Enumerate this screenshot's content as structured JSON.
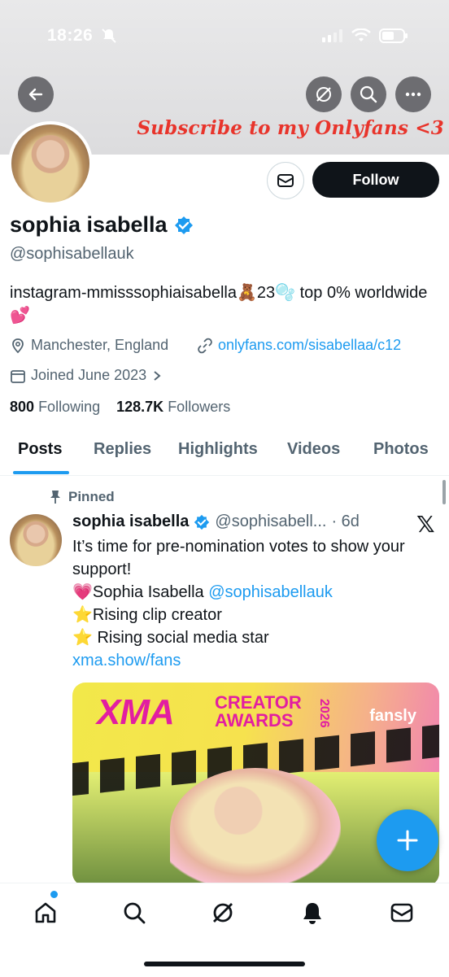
{
  "status_bar": {
    "time": "18:26"
  },
  "banner": {
    "text": "Subscribe to my Onlyfans <3"
  },
  "profile": {
    "name": "sophia isabella",
    "handle": "@sophisabellauk",
    "bio": "instagram-mmisssophiaisabella🧸23🫧 top 0% worldwide💕",
    "location": "Manchester, England",
    "website": "onlyfans.com/sisabellaa/c12",
    "joined": "Joined June 2023",
    "following_count": "800",
    "following_label": "Following",
    "followers_count": "128.7K",
    "followers_label": "Followers",
    "follow_button": "Follow"
  },
  "tabs": [
    "Posts",
    "Replies",
    "Highlights",
    "Videos",
    "Photos"
  ],
  "pinned_tweet": {
    "pinned_label": "Pinned",
    "author_name": "sophia isabella",
    "author_handle": "@sophisabell...",
    "time": "· 6d",
    "line1": "It’s time for pre-nomination votes to show your support!",
    "line2_prefix": "💗Sophia Isabella ",
    "line2_mention": "@sophisabellauk",
    "line3": "⭐Rising clip creator",
    "line4": "⭐ Rising social media star",
    "link": "xma.show/fans",
    "media": {
      "logo": "XMA",
      "creator": "CREATOR",
      "awards": "AWARDS",
      "year": "2026",
      "sponsor": "fansly"
    }
  },
  "fab": {
    "icon": "plus-icon"
  },
  "bottom_nav": [
    "home-icon",
    "search-icon",
    "grok-icon",
    "notifications-icon",
    "messages-icon"
  ],
  "colors": {
    "accent": "#1d9bf0",
    "text": "#0f1419",
    "muted": "#536471",
    "banner_text": "#e8342b"
  }
}
